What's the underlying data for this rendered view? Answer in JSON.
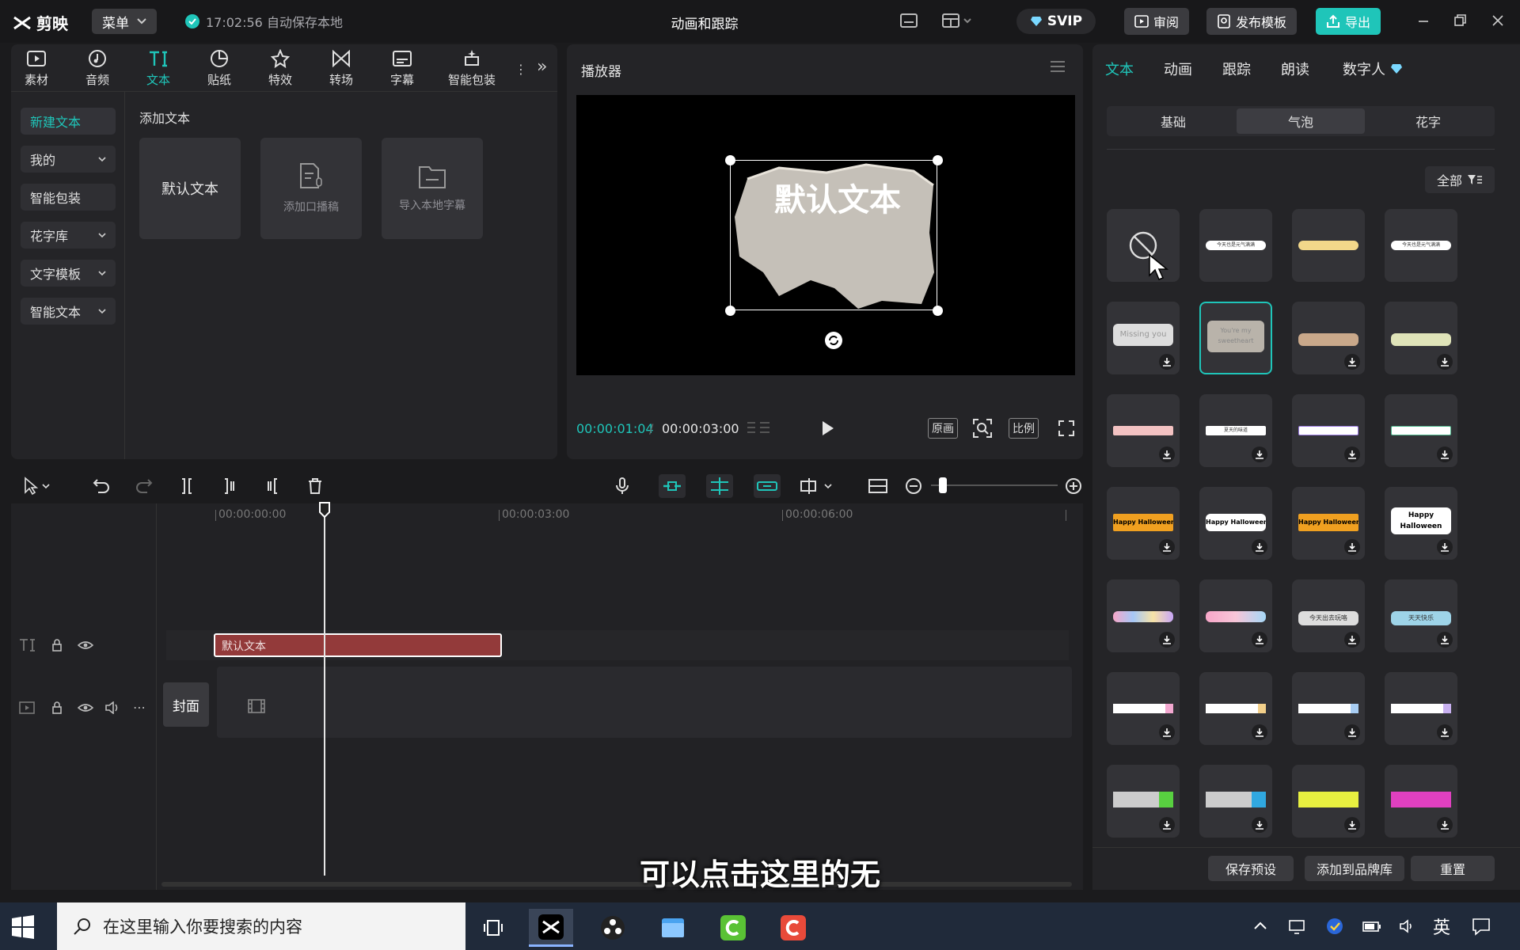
{
  "app": {
    "logo_text": "剪映",
    "menu_label": "菜单",
    "autosave_text": "17:02:56 自动保存本地",
    "project_title": "动画和跟踪",
    "svip_label": "SVIP",
    "review_label": "审阅",
    "publish_template_label": "发布模板",
    "export_label": "导出"
  },
  "media_categories": [
    {
      "label": "素材",
      "icon": "media-icon"
    },
    {
      "label": "音频",
      "icon": "audio-icon"
    },
    {
      "label": "文本",
      "icon": "text-icon",
      "active": true
    },
    {
      "label": "贴纸",
      "icon": "sticker-icon"
    },
    {
      "label": "特效",
      "icon": "effects-icon"
    },
    {
      "label": "转场",
      "icon": "transition-icon"
    },
    {
      "label": "字幕",
      "icon": "caption-icon"
    },
    {
      "label": "智能包装",
      "icon": "smart-pack-icon"
    }
  ],
  "text_nav": [
    {
      "label": "新建文本",
      "active": true
    },
    {
      "label": "我的",
      "dropdown": true
    },
    {
      "label": "智能包装"
    },
    {
      "label": "花字库",
      "dropdown": true
    },
    {
      "label": "文字模板",
      "dropdown": true
    },
    {
      "label": "智能文本",
      "dropdown": true
    }
  ],
  "add_text": {
    "title": "添加文本",
    "default_tile": "默认文本",
    "voiceover_tile": "添加口播稿",
    "import_tile": "导入本地字幕"
  },
  "player": {
    "title": "播放器",
    "canvas_text": "默认文本",
    "current_time": "00:00:01:04",
    "total_time": "00:00:03:00",
    "original_label": "原画",
    "ratio_label": "比例"
  },
  "right_panel": {
    "tabs": [
      {
        "label": "文本",
        "active": true
      },
      {
        "label": "动画"
      },
      {
        "label": "跟踪"
      },
      {
        "label": "朗读"
      },
      {
        "label": "数字人"
      }
    ],
    "segments": [
      "基础",
      "气泡",
      "花字"
    ],
    "active_segment": "气泡",
    "filter_label": "全部",
    "bubbles": {
      "b1": "今天也是元气满满",
      "b3": "今天也是元气满满",
      "missing": "Missing you",
      "sweet": "You're my sweetheart",
      "halloween": "Happy Halloween",
      "t1": "今天出去玩咯",
      "t2": "天天快乐",
      "summer": "夏天的味道"
    },
    "save_preset": "保存预设",
    "add_brand": "添加到品牌库",
    "reset": "重置"
  },
  "timeline": {
    "ruler": [
      "00:00:00:00",
      "00:00:03:00",
      "00:00:06:00"
    ],
    "text_clip": "默认文本",
    "cover_label": "封面"
  },
  "subtitle": "可以点击这里的无",
  "taskbar": {
    "search_placeholder": "在这里输入你要搜索的内容",
    "ime": "英"
  },
  "colors": {
    "accent": "#1fc5b9",
    "text_clip": "#933a3a",
    "bg": "#1b1b1d"
  }
}
